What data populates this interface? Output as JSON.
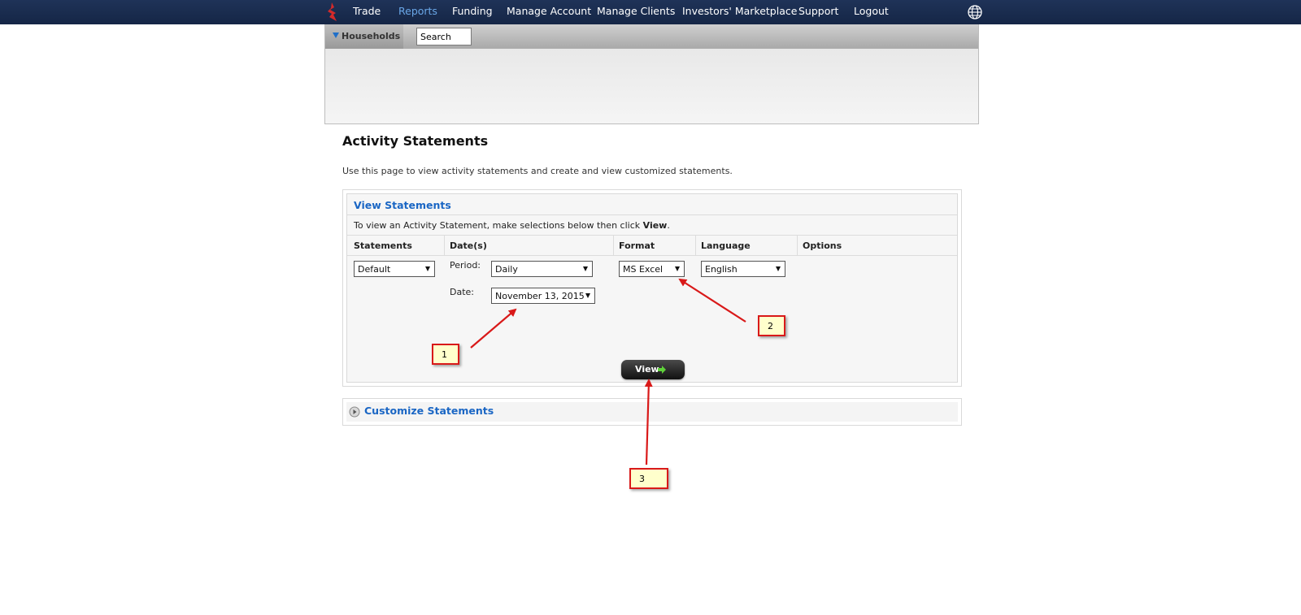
{
  "nav": {
    "items": [
      "Trade",
      "Reports",
      "Funding",
      "Manage Account",
      "Manage Clients",
      "Investors' Marketplace",
      "Support",
      "Logout"
    ],
    "active": "Reports"
  },
  "households": {
    "label": "Households",
    "search_value": "Search"
  },
  "page": {
    "title": "Activity Statements",
    "intro": "Use this page to view activity statements and create and view customized statements."
  },
  "view_statements": {
    "title": "View Statements",
    "instruction_prefix": "To view an Activity Statement, make selections below then click ",
    "instruction_bold": "View",
    "instruction_suffix": ".",
    "columns": [
      "Statements",
      "Date(s)",
      "Format",
      "Language",
      "Options"
    ],
    "statements_select": "Default",
    "period_label": "Period:",
    "period_select": "Daily",
    "date_label": "Date:",
    "date_select": "November 13, 2015",
    "format_select": "MS Excel",
    "language_select": "English",
    "view_button": "View"
  },
  "customize": {
    "label": "Customize Statements"
  },
  "annotations": {
    "callouts": [
      "1",
      "2",
      "3"
    ],
    "arrow_color": "#d91919"
  },
  "colors": {
    "nav_bg": "#1f3358",
    "active_nav": "#6aa7e8",
    "link_blue": "#1a66c4"
  }
}
